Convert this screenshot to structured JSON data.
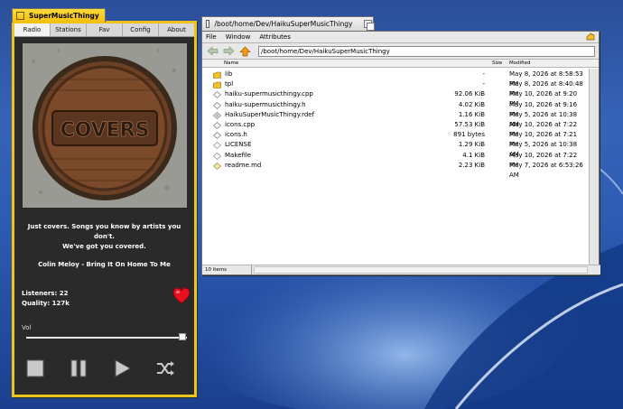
{
  "colors": {
    "active_tab": "#f5c518",
    "heart": "#e8101e",
    "desktop": "#2d5bb2"
  },
  "music_window": {
    "title": "SuperMusicThingy",
    "tabs": [
      "Radio",
      "Stations",
      "Fav",
      "Config",
      "About"
    ],
    "selected_tab": "Radio",
    "album_art_text": "COVERS",
    "description_line1": "Just covers. Songs you know by artists you don't.",
    "description_line2": "We've got you covered.",
    "now_playing": "Colin Meloy - Bring It On Home To Me",
    "listeners": "Listeners: 22",
    "quality": "Quality: 127k",
    "volume_label": "Vol",
    "volume_level": 0.97,
    "controls": [
      "stop-icon",
      "pause-icon",
      "play-icon",
      "shuffle-icon"
    ]
  },
  "tracker_window": {
    "title": "/boot/home/Dev/HaikuSuperMusicThingy",
    "menu": [
      "File",
      "Window",
      "Attributes"
    ],
    "path": "/boot/home/Dev/HaikuSuperMusicThingy",
    "columns": {
      "name": "Name",
      "size": "Size",
      "modified": "Modified"
    },
    "files": [
      {
        "name": "lib",
        "size": "-",
        "modified": "May 8, 2026 at 8:58:53 PM",
        "icon": "folder-icon"
      },
      {
        "name": "tpl",
        "size": "-",
        "modified": "May 8, 2026 at 8:40:48 PM",
        "icon": "folder-icon"
      },
      {
        "name": "haiku-supermusicthingy.cpp",
        "size": "92.06 KiB",
        "modified": "May 10, 2026 at 9:20 PM",
        "icon": "source-file-icon"
      },
      {
        "name": "haiku-supermusicthingy.h",
        "size": "4.02 KiB",
        "modified": "May 10, 2026 at 9:16 PM",
        "icon": "source-file-icon"
      },
      {
        "name": "HaikuSuperMusicThingy.rdef",
        "size": "1.16 KiB",
        "modified": "May 5, 2026 at 10:38 AM",
        "icon": "resource-file-icon"
      },
      {
        "name": "icons.cpp",
        "size": "57.53 KiB",
        "modified": "May 10, 2026 at 7:22 PM",
        "icon": "source-file-icon"
      },
      {
        "name": "icons.h",
        "size": "891 bytes",
        "modified": "May 10, 2026 at 7:21 PM",
        "icon": "source-file-icon"
      },
      {
        "name": "LICENSE",
        "size": "1.29 KiB",
        "modified": "May 5, 2026 at 10:38 AM",
        "icon": "text-file-icon"
      },
      {
        "name": "Makefile",
        "size": "4.1 KiB",
        "modified": "May 10, 2026 at 7:22 PM",
        "icon": "text-file-icon"
      },
      {
        "name": "readme.md",
        "size": "2.23 KiB",
        "modified": "May 7, 2026 at 6:53:26 AM",
        "icon": "document-file-icon"
      }
    ],
    "item_count": "10 items"
  }
}
